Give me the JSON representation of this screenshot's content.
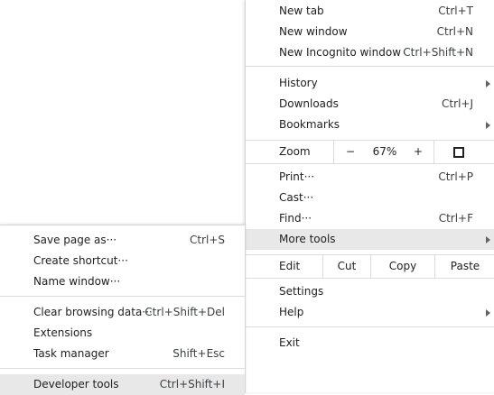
{
  "main_menu": {
    "new_tab": {
      "label": "New tab",
      "shortcut": "Ctrl+T"
    },
    "new_window": {
      "label": "New window",
      "shortcut": "Ctrl+N"
    },
    "new_incognito": {
      "label": "New Incognito window",
      "shortcut": "Ctrl+Shift+N"
    },
    "history": {
      "label": "History"
    },
    "downloads": {
      "label": "Downloads",
      "shortcut": "Ctrl+J"
    },
    "bookmarks": {
      "label": "Bookmarks"
    },
    "zoom": {
      "label": "Zoom",
      "minus": "−",
      "level": "67%",
      "plus": "+",
      "fullscreen_icon": "fullscreen-icon"
    },
    "print": {
      "label": "Print···",
      "shortcut": "Ctrl+P"
    },
    "cast": {
      "label": "Cast···"
    },
    "find": {
      "label": "Find···",
      "shortcut": "Ctrl+F"
    },
    "more_tools": {
      "label": "More tools"
    },
    "edit": {
      "label": "Edit",
      "cut": "Cut",
      "copy": "Copy",
      "paste": "Paste"
    },
    "settings": {
      "label": "Settings"
    },
    "help": {
      "label": "Help"
    },
    "exit": {
      "label": "Exit"
    }
  },
  "sub_menu": {
    "save_page": {
      "label": "Save page as···",
      "shortcut": "Ctrl+S"
    },
    "create_shortcut": {
      "label": "Create shortcut···"
    },
    "name_window": {
      "label": "Name window···"
    },
    "clear_browsing": {
      "label": "Clear browsing data···",
      "shortcut": "Ctrl+Shift+Del"
    },
    "extensions": {
      "label": "Extensions"
    },
    "task_manager": {
      "label": "Task manager",
      "shortcut": "Shift+Esc"
    },
    "developer_tools": {
      "label": "Developer tools",
      "shortcut": "Ctrl+Shift+I"
    }
  },
  "colors": {
    "highlight": "#e8e8e8",
    "separator": "#dcdcdc",
    "text": "#202124"
  }
}
